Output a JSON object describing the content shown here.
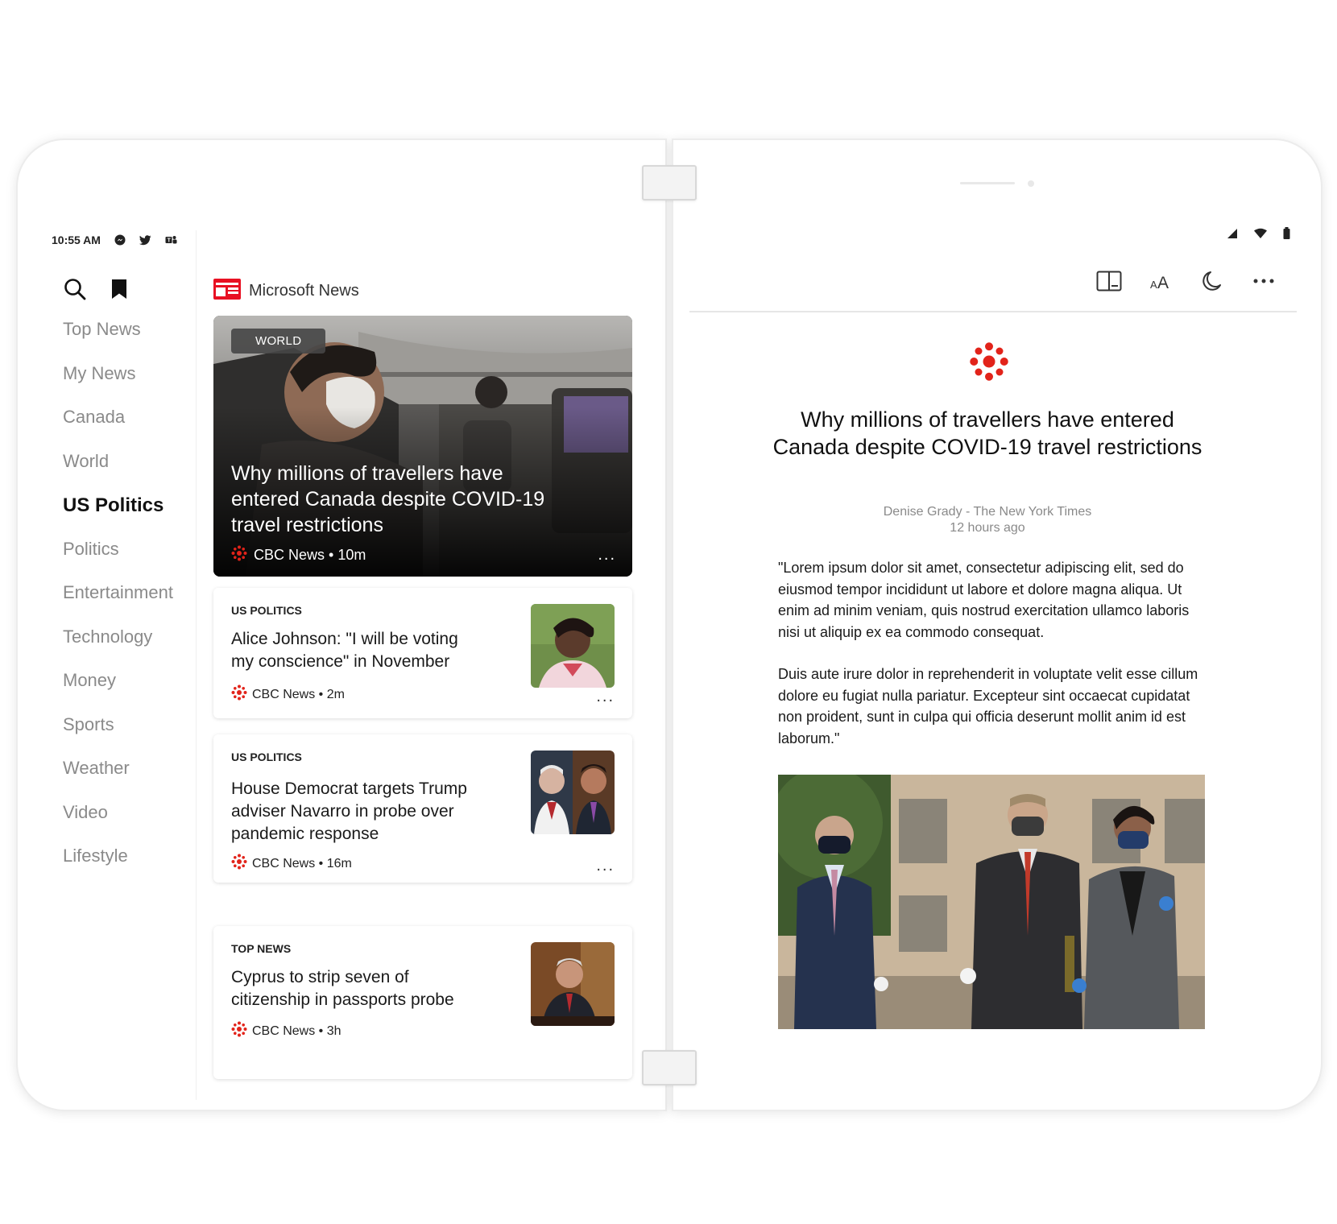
{
  "status": {
    "time": "10:55 AM",
    "left_icons": [
      "messenger-icon",
      "twitter-icon",
      "teams-icon"
    ],
    "right_icons": [
      "signal-icon",
      "wifi-icon",
      "battery-icon"
    ]
  },
  "nav": {
    "tool_icons": [
      "search-icon",
      "bookmark-icon"
    ],
    "items": [
      "Top News",
      "My News",
      "Canada",
      "World",
      "US Politics",
      "Politics",
      "Entertainment",
      "Technology",
      "Money",
      "Sports",
      "Weather",
      "Video",
      "Lifestyle"
    ],
    "active": "US Politics"
  },
  "brand": {
    "name": "Microsoft News",
    "color": "#e81123"
  },
  "feed": {
    "hero": {
      "category": "WORLD",
      "title": "Why millions of travellers have entered Canada despite COVID-19 travel restrictions",
      "meta": "CBC News • 10m",
      "more": "..."
    },
    "cards": [
      {
        "category": "US POLITICS",
        "title": "Alice Johnson: \"I will be voting my conscience\" in November",
        "meta": "CBC News • 2m",
        "more": "..."
      },
      {
        "category": "US POLITICS",
        "title": "House Democrat targets Trump adviser Navarro in probe over pandemic response",
        "meta": "CBC News • 16m",
        "more": "..."
      },
      {
        "category": "TOP NEWS",
        "title": "Cyprus to strip seven of citizenship in passports probe",
        "meta": "CBC News • 3h"
      }
    ]
  },
  "reader": {
    "toolbar": [
      "dual-screen-icon",
      "text-size-icon",
      "dark-mode-icon",
      "more-options-icon"
    ],
    "title": "Why millions of travellers have entered Canada despite COVID-19 travel restrictions",
    "byline": "Denise Grady - The New York Times",
    "time": "12 hours ago",
    "paragraphs": [
      "\"Lorem ipsum dolor sit amet, consectetur adipiscing elit, sed do eiusmod tempor incididunt ut labore et dolore magna aliqua. Ut enim ad minim veniam, quis nostrud exercitation ullamco laboris nisi ut aliquip ex ea commodo consequat.",
      "Duis aute irure dolor in reprehenderit in voluptate velit esse cillum dolore eu fugiat nulla pariatur. Excepteur sint occaecat cupidatat non proident, sunt in culpa qui officia deserunt mollit anim id est laborum.\""
    ]
  },
  "colors": {
    "cbc_red": "#e2231a",
    "nav_inactive": "#8a8a8a",
    "text": "#1a1a1a"
  }
}
